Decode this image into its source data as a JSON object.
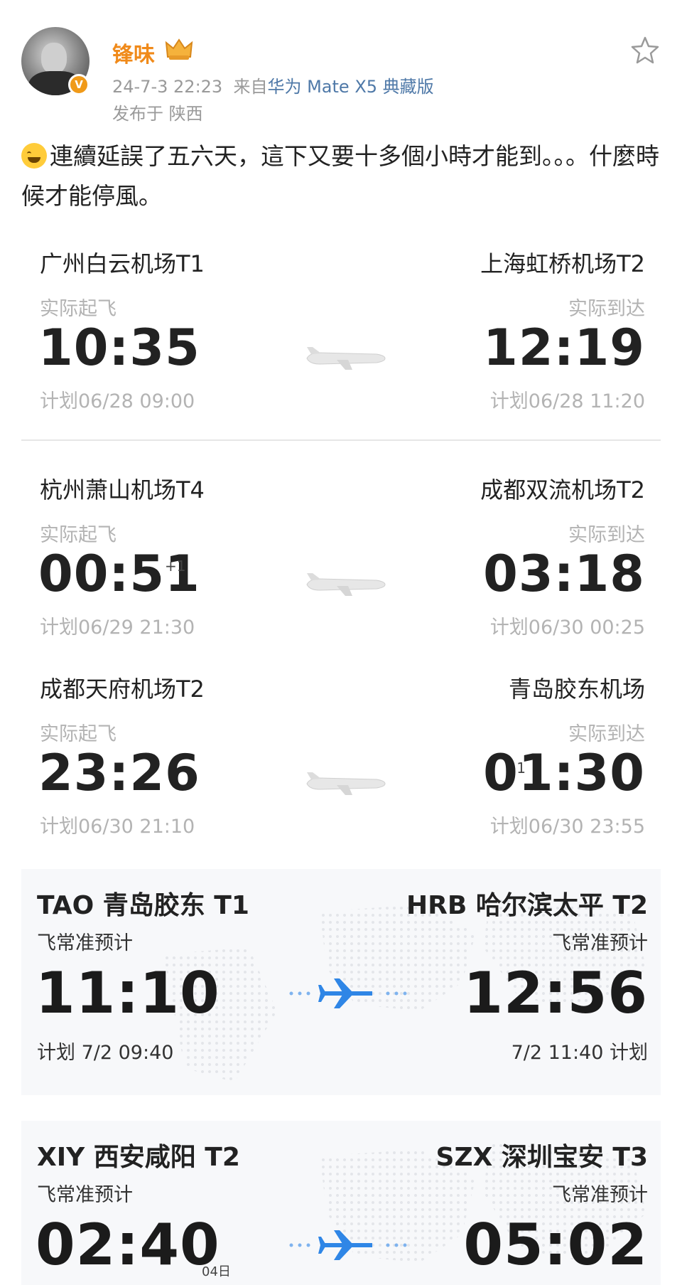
{
  "header": {
    "username": "锋味",
    "timestamp": "24-7-3 22:23",
    "source_prefix": "来自",
    "device": "华为 Mate X5 典藏版",
    "location": "发布于 陕西",
    "verified_badge": "V"
  },
  "post": {
    "emoji": "laughing-crying-emoji",
    "text": "連續延誤了五六天，這下又要十多個小時才能到。。。什麼時候才能停風。"
  },
  "flights": [
    {
      "dep_airport": "广州白云机场T1",
      "arr_airport": "上海虹桥机场T2",
      "dep_label": "实际起飞",
      "arr_label": "实际到达",
      "dep_time": "10:35",
      "arr_time": "12:19",
      "dep_plan": "计划06/28 09:00",
      "arr_plan": "计划06/28 11:20"
    },
    {
      "dep_airport": "杭州萧山机场T4",
      "arr_airport": "成都双流机场T2",
      "dep_label": "实际起飞",
      "arr_label": "实际到达",
      "dep_time": "00:51",
      "dep_plus": "+1",
      "arr_time": "03:18",
      "dep_plan": "计划06/29 21:30",
      "arr_plan": "计划06/30 00:25"
    },
    {
      "dep_airport": "成都天府机场T2",
      "arr_airport": "青岛胶东机场",
      "dep_label": "实际起飞",
      "arr_label": "实际到达",
      "dep_time": "23:26",
      "arr_time": "01:30",
      "arr_plus": "+1",
      "dep_plan": "计划06/30 21:10",
      "arr_plan": "计划06/30 23:55"
    }
  ],
  "fcz_flights": [
    {
      "dep_airport": "TAO 青岛胶东 T1",
      "arr_airport": "HRB 哈尔滨太平 T2",
      "dep_label": "飞常准预计",
      "arr_label": "飞常准预计",
      "dep_time": "11:10",
      "arr_time": "12:56",
      "dep_plan": "计划 7/2 09:40",
      "arr_plan": "7/2 11:40 计划"
    },
    {
      "dep_airport": "XIY 西安咸阳 T2",
      "arr_airport": "SZX 深圳宝安 T3",
      "dep_label": "飞常准预计",
      "arr_label": "飞常准预计",
      "dep_time": "02:40",
      "dep_day": "04日",
      "arr_time": "05:02"
    }
  ],
  "colors": {
    "username": "#f08a1a",
    "device_link": "#4f79a8",
    "muted": "#b3b3b3",
    "plane_blue": "#2f86e6"
  }
}
